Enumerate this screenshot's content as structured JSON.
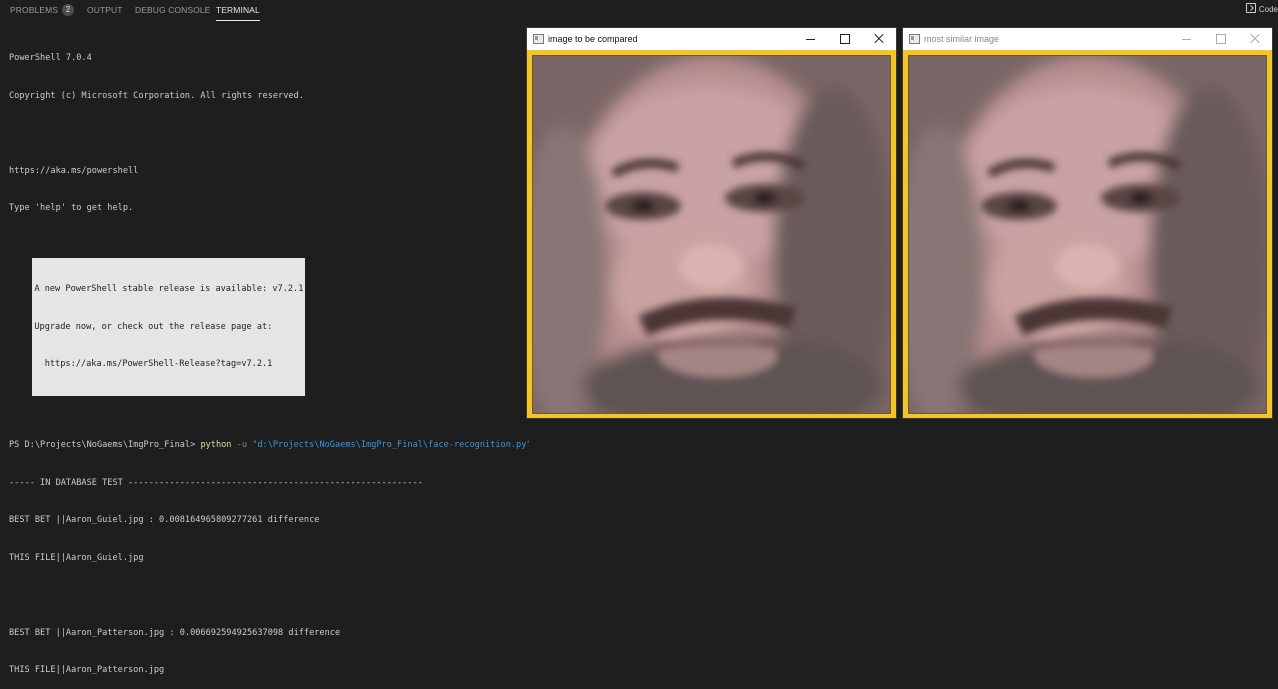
{
  "panel": {
    "tabs": [
      {
        "label": "PROBLEMS",
        "badge": "2"
      },
      {
        "label": "OUTPUT"
      },
      {
        "label": "DEBUG CONSOLE"
      },
      {
        "label": "TERMINAL",
        "active": true
      }
    ],
    "right_button": {
      "label": "Code",
      "icon": "code-icon"
    }
  },
  "terminal": {
    "intro": [
      "PowerShell 7.0.4",
      "Copyright (c) Microsoft Corporation. All rights reserved.",
      "",
      "https://aka.ms/powershell",
      "Type 'help' to get help."
    ],
    "notice": [
      "A new PowerShell stable release is available: v7.2.1",
      "Upgrade now, or check out the release page at:",
      "  https://aka.ms/PowerShell-Release?tag=v7.2.1"
    ],
    "prompt": "PS D:\\Projects\\NoGaems\\ImgPro_Final> ",
    "command": "python",
    "flag": " -u ",
    "path": "\"d:\\Projects\\NoGaems\\ImgPro_Final\\face-recognition.py\"",
    "output": [
      "----- IN DATABASE TEST ---------------------------------------------------------",
      "BEST BET ||Aaron_Guiel.jpg : 0.008164965809277261 difference",
      "THIS FILE||Aaron_Guiel.jpg",
      "",
      "BEST BET ||Aaron_Patterson.jpg : 0.006692594925637098 difference",
      "THIS FILE||Aaron_Patterson.jpg"
    ]
  },
  "windows": [
    {
      "title": "image to be compared",
      "icon": "app-icon",
      "active": true
    },
    {
      "title": "most similar image",
      "icon": "app-icon",
      "active": false
    }
  ],
  "colors": {
    "terminal_bg": "#1e1e1e",
    "terminal_fg": "#cccccc",
    "window_border": "#f3c528",
    "command_yellow": "#dcdcaa",
    "string_blue": "#3a96dd"
  }
}
